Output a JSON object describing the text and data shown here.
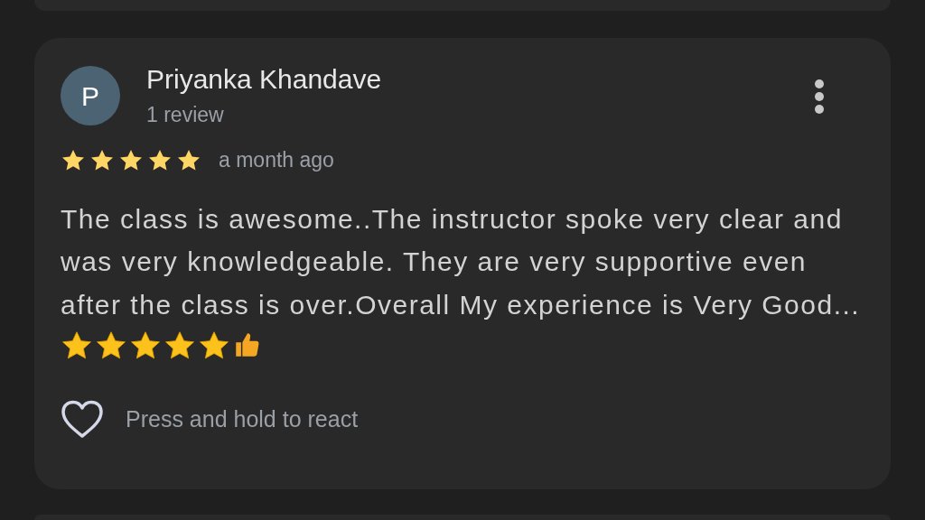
{
  "review": {
    "avatar_letter": "P",
    "author": "Priyanka Khandave",
    "author_meta": "1 review",
    "stars": 5,
    "time": "a month ago",
    "text": "The class is awesome..The instructor spoke very clear and was very knowledgeable. They are very supportive even after the class is over.Overall My experience is Very Good...",
    "emoji": {
      "stars": 5
    },
    "react_hint": "Press and hold to react"
  }
}
